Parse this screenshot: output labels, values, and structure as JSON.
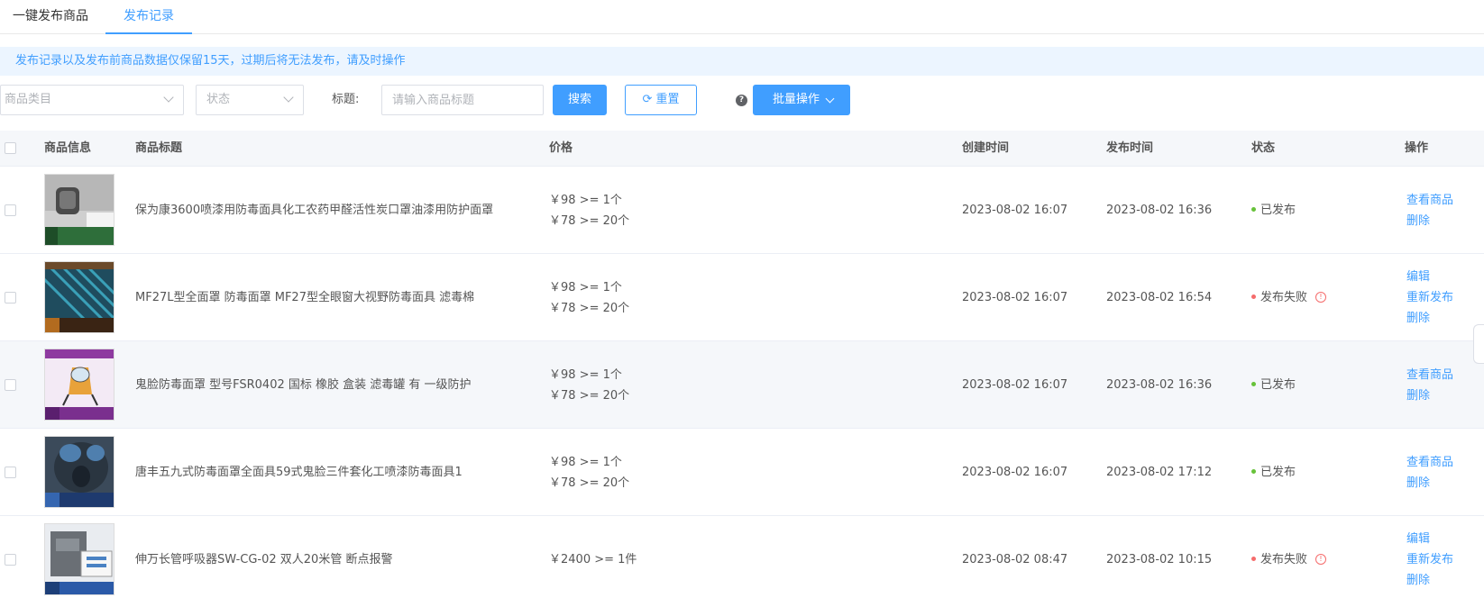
{
  "tabs": [
    {
      "label": "一键发布商品"
    },
    {
      "label": "发布记录"
    }
  ],
  "notice": "发布记录以及发布前商品数据仅保留15天，过期后将无法发布，请及时操作",
  "filters": {
    "category_placeholder": "商品类目",
    "status_placeholder": "状态",
    "title_label": "标题:",
    "title_placeholder": "请输入商品标题",
    "search_label": "搜索",
    "reset_label": "重置",
    "help_glyph": "?",
    "batch_label": "批量操作"
  },
  "table": {
    "headers": {
      "info": "商品信息",
      "title": "商品标题",
      "price": "价格",
      "created": "创建时间",
      "published": "发布时间",
      "status": "状态",
      "ops": "操作"
    },
    "rows": [
      {
        "title": "保为康3600喷漆用防毒面具化工农药甲醛活性炭口罩油漆用防护面罩",
        "prices": [
          "￥98 >= 1个",
          "￥78 >= 20个"
        ],
        "created": "2023-08-02 16:07",
        "published": "2023-08-02 16:36",
        "status": "已发布",
        "status_color": "#67c23a",
        "ops": [
          "查看商品",
          "删除"
        ]
      },
      {
        "title": "MF27L型全面罩 防毒面罩 MF27型全眼窗大视野防毒面具 滤毒棉",
        "prices": [
          "￥98 >= 1个",
          "￥78 >= 20个"
        ],
        "created": "2023-08-02 16:07",
        "published": "2023-08-02 16:54",
        "status": "发布失败",
        "status_color": "#f56c6c",
        "warn_glyph": "!",
        "ops": [
          "编辑",
          "重新发布",
          "删除"
        ]
      },
      {
        "title": "鬼脸防毒面罩 型号FSR0402 国标 橡胶 盒装 滤毒罐 有 一级防护",
        "prices": [
          "￥98 >= 1个",
          "￥78 >= 20个"
        ],
        "created": "2023-08-02 16:07",
        "published": "2023-08-02 16:36",
        "status": "已发布",
        "status_color": "#67c23a",
        "ops": [
          "查看商品",
          "删除"
        ]
      },
      {
        "title": "唐丰五九式防毒面罩全面具59式鬼脸三件套化工喷漆防毒面具1",
        "prices": [
          "￥98 >= 1个",
          "￥78 >= 20个"
        ],
        "created": "2023-08-02 16:07",
        "published": "2023-08-02 17:12",
        "status": "已发布",
        "status_color": "#67c23a",
        "ops": [
          "查看商品",
          "删除"
        ]
      },
      {
        "title": "伸万长管呼吸器SW-CG-02 双人20米管 断点报警",
        "prices": [
          "￥2400 >= 1件"
        ],
        "created": "2023-08-02 08:47",
        "published": "2023-08-02 10:15",
        "status": "发布失败",
        "status_color": "#f56c6c",
        "warn_glyph": "!",
        "ops": [
          "编辑",
          "重新发布",
          "删除"
        ]
      }
    ]
  },
  "colors": {
    "accent": "#409eff",
    "success": "#67c23a",
    "danger": "#f56c6c"
  }
}
